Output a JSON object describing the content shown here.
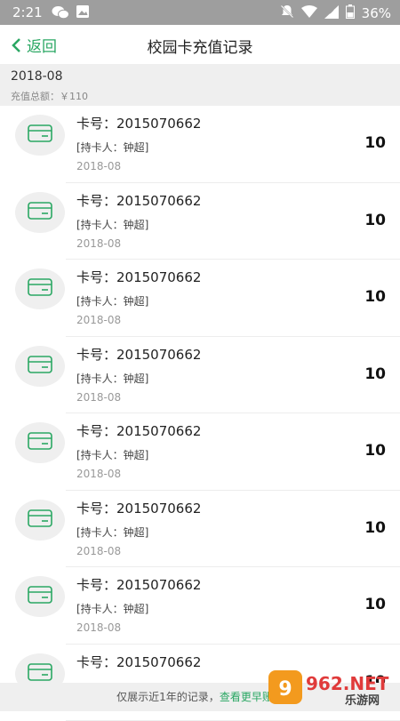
{
  "status": {
    "time": "2:21",
    "battery": "36%"
  },
  "nav": {
    "back_label": "返回",
    "title": "校园卡充值记录"
  },
  "summary": {
    "month": "2018-08",
    "total_label": "充值总额：",
    "total_value": "￥110"
  },
  "records": [
    {
      "card": "卡号：2015070662",
      "holder": "[持卡人：钟超]",
      "date": "2018-08",
      "amount": "10"
    },
    {
      "card": "卡号：2015070662",
      "holder": "[持卡人：钟超]",
      "date": "2018-08",
      "amount": "10"
    },
    {
      "card": "卡号：2015070662",
      "holder": "[持卡人：钟超]",
      "date": "2018-08",
      "amount": "10"
    },
    {
      "card": "卡号：2015070662",
      "holder": "[持卡人：钟超]",
      "date": "2018-08",
      "amount": "10"
    },
    {
      "card": "卡号：2015070662",
      "holder": "[持卡人：钟超]",
      "date": "2018-08",
      "amount": "10"
    },
    {
      "card": "卡号：2015070662",
      "holder": "[持卡人：钟超]",
      "date": "2018-08",
      "amount": "10"
    },
    {
      "card": "卡号：2015070662",
      "holder": "[持卡人：钟超]",
      "date": "2018-08",
      "amount": "10"
    },
    {
      "card": "卡号：2015070662",
      "holder": "",
      "date": "",
      "amount": "10"
    }
  ],
  "footer": {
    "text": "仅展示近1年的记录，",
    "link": "查看更早账单"
  },
  "watermark": {
    "brand": "962.NET",
    "sub": "乐游网"
  },
  "colors": {
    "accent": "#2aa763",
    "status_bar": "#9e9e9e"
  }
}
